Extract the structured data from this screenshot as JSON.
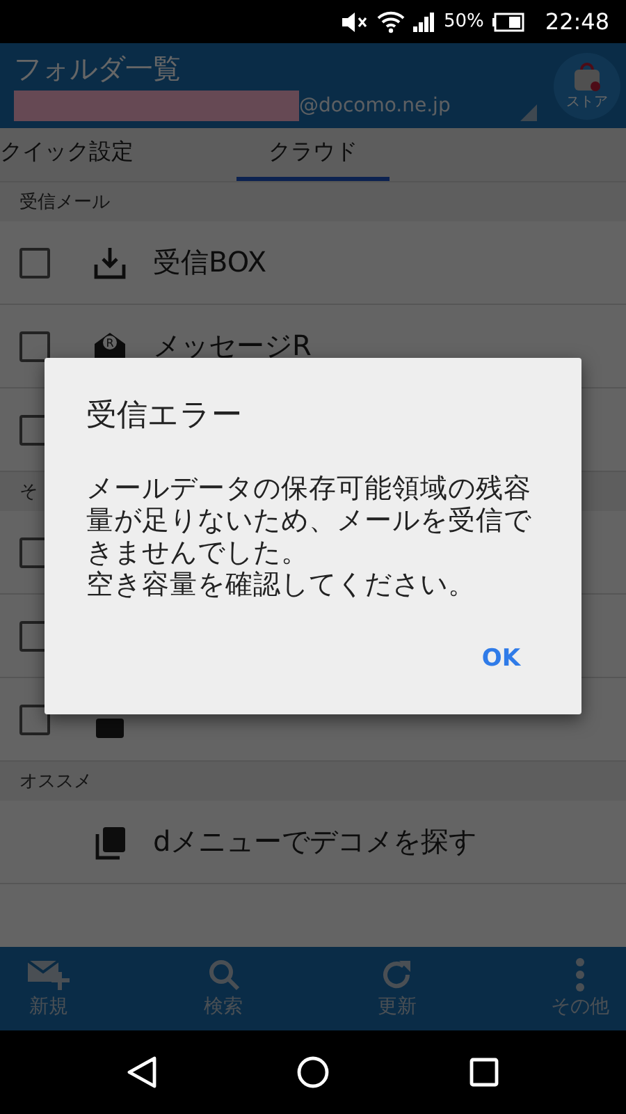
{
  "status_bar": {
    "battery": "50%",
    "time": "22:48"
  },
  "header": {
    "title": "フォルダ一覧",
    "account": "@docomo.ne.jp",
    "store_label": "ストア"
  },
  "tabs": [
    {
      "label": "クイック設定",
      "selected": false
    },
    {
      "label": "クラウド",
      "selected": true
    }
  ],
  "sections": [
    {
      "label": "受信メール",
      "items": [
        {
          "kind": "checkbox",
          "checked": false,
          "label": "受信BOX"
        },
        {
          "kind": "checkbox",
          "checked": false,
          "label": "メッセージR",
          "icon_text": "R"
        },
        {
          "kind": "checkbox",
          "checked": false
        }
      ]
    },
    {
      "label": "そ",
      "items": [
        {
          "kind": "checkbox",
          "checked": false
        },
        {
          "kind": "checkbox",
          "checked": false
        },
        {
          "kind": "checkbox",
          "checked": false
        }
      ]
    },
    {
      "label": "オススメ",
      "items": [
        {
          "kind": "link",
          "label": "dメニューでデコメを探す"
        }
      ]
    }
  ],
  "toolbar": [
    "新規",
    "検索",
    "更新",
    "その他"
  ],
  "dialog": {
    "title": "受信エラー",
    "message": [
      "メールデータの保存可能領域の残容量が足りないため、メールを受信できませんでした。",
      "空き容量を確認してください。"
    ],
    "button": "OK"
  }
}
